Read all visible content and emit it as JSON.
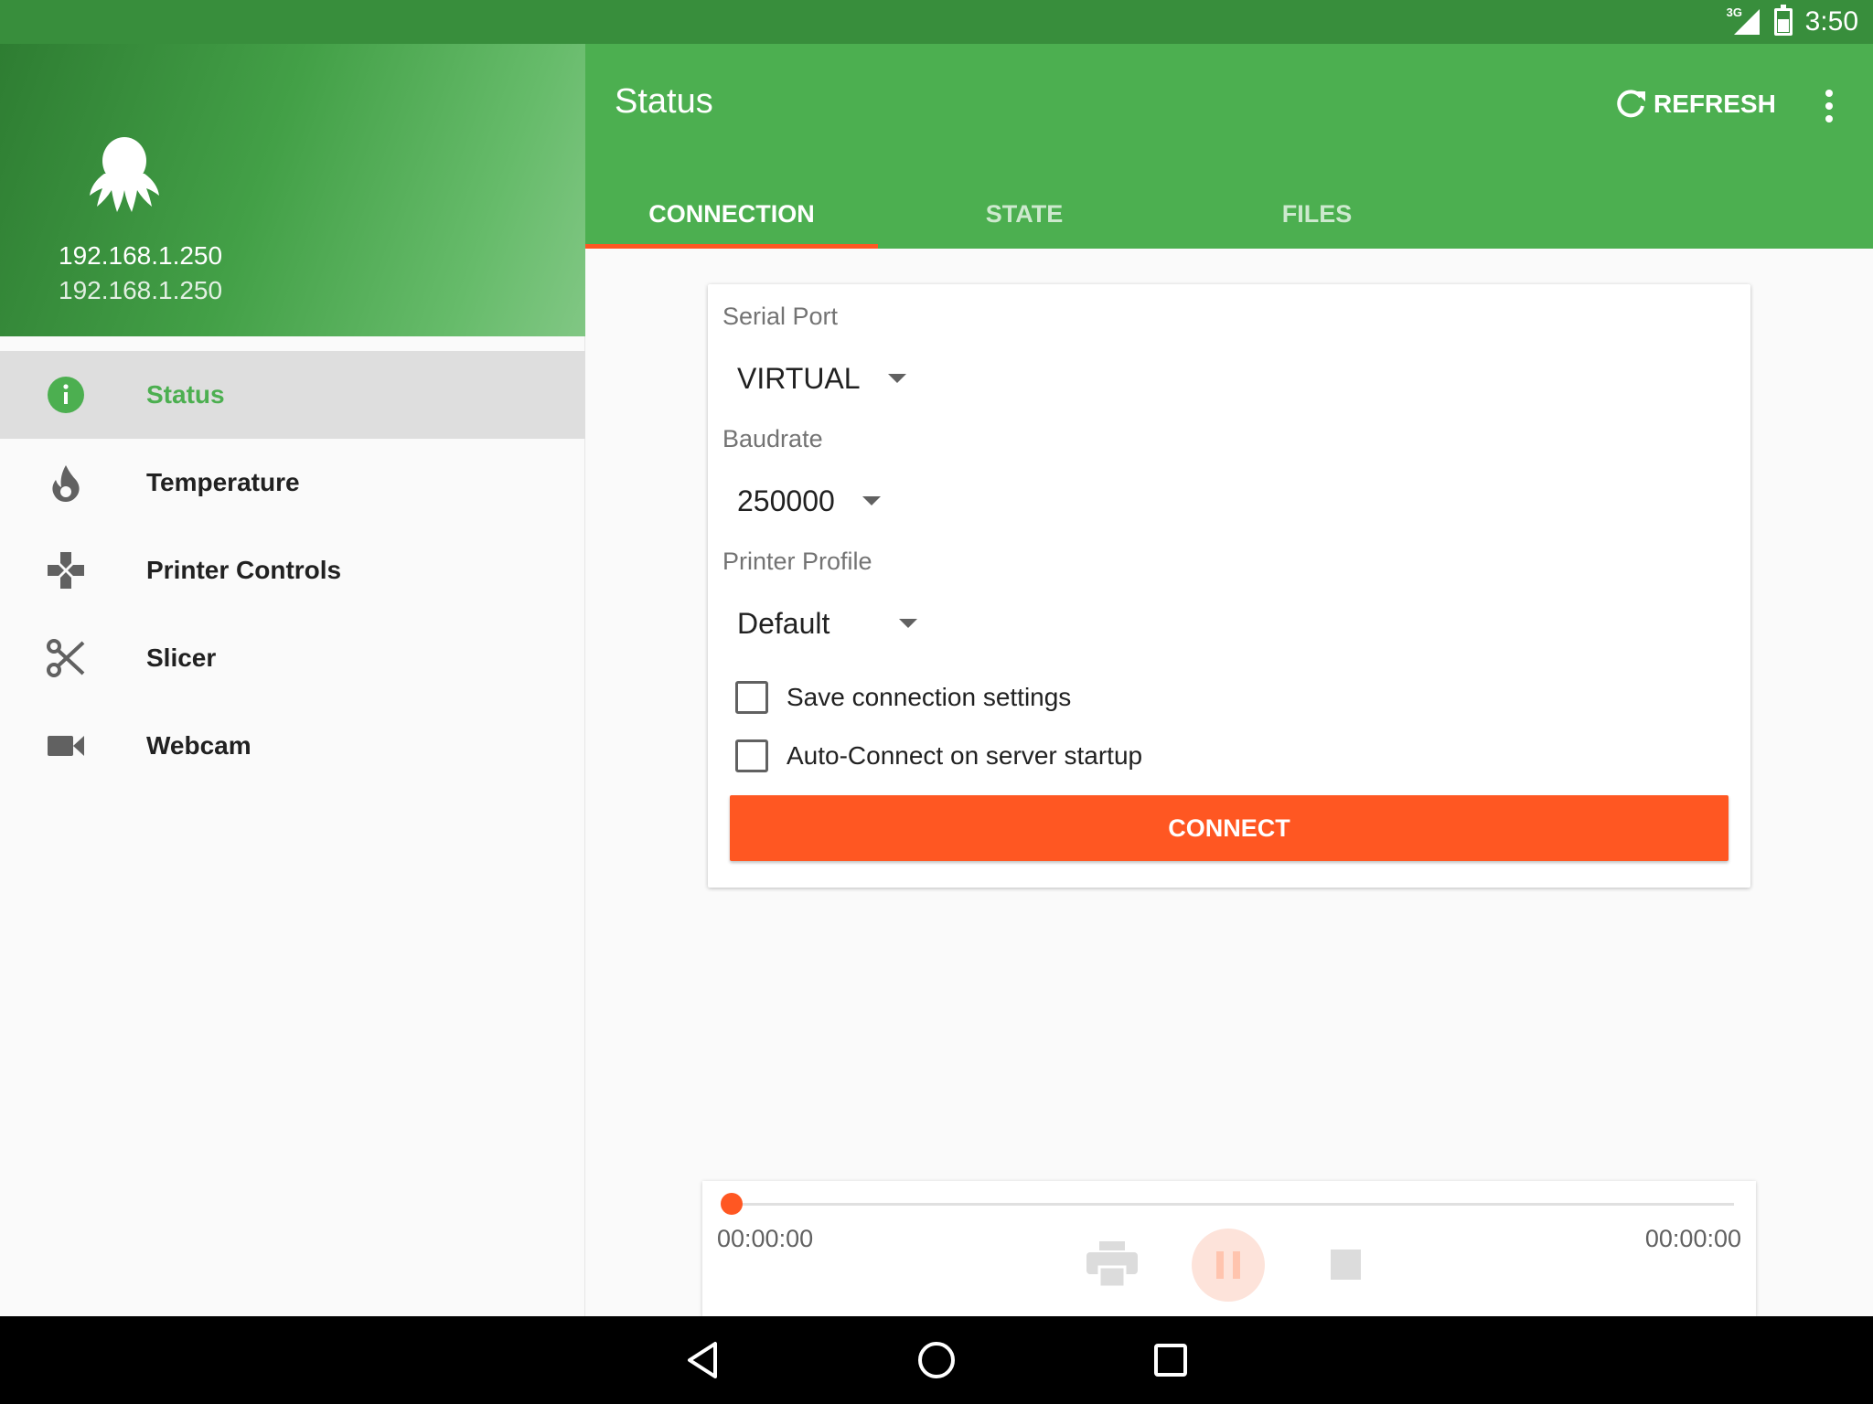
{
  "system": {
    "time": "3:50",
    "network": "3G",
    "icons": [
      "signal-icon",
      "battery-icon"
    ]
  },
  "drawer": {
    "header": {
      "logo": "octopus-logo-icon",
      "ip_primary": "192.168.1.250",
      "ip_secondary": "192.168.1.250"
    },
    "items": [
      {
        "label": "Status",
        "icon": "info-icon",
        "active": true
      },
      {
        "label": "Temperature",
        "icon": "flame-icon",
        "active": false
      },
      {
        "label": "Printer Controls",
        "icon": "gamepad-icon",
        "active": false
      },
      {
        "label": "Slicer",
        "icon": "scissors-icon",
        "active": false
      },
      {
        "label": "Webcam",
        "icon": "videocam-icon",
        "active": false
      }
    ]
  },
  "toolbar": {
    "title": "Status",
    "refresh_label": "REFRESH"
  },
  "tabs": [
    {
      "label": "CONNECTION",
      "active": true
    },
    {
      "label": "STATE",
      "active": false
    },
    {
      "label": "FILES",
      "active": false
    }
  ],
  "connection": {
    "serial_port": {
      "label": "Serial Port",
      "value": "VIRTUAL"
    },
    "baudrate": {
      "label": "Baudrate",
      "value": "250000"
    },
    "printer_profile": {
      "label": "Printer Profile",
      "value": "Default"
    },
    "save_settings": {
      "label": "Save connection settings",
      "checked": false
    },
    "auto_connect": {
      "label": "Auto-Connect on server startup",
      "checked": false
    },
    "connect_label": "CONNECT"
  },
  "job": {
    "progress": 0,
    "elapsed": "00:00:00",
    "remaining": "00:00:00"
  },
  "colors": {
    "primary": "#4caf50",
    "primary_dark": "#388e3c",
    "accent": "#ff5722"
  }
}
